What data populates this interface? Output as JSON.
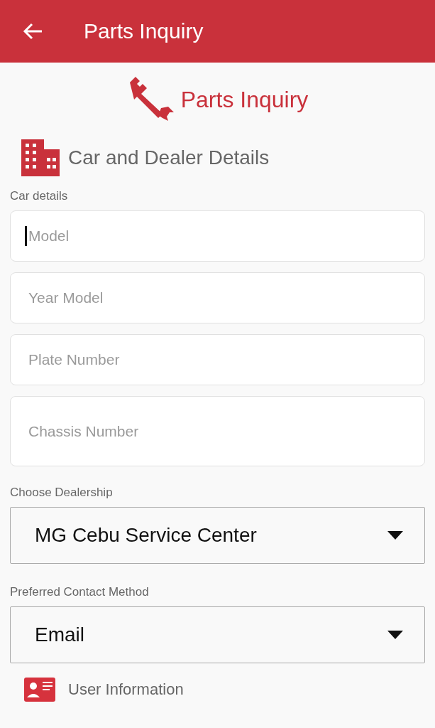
{
  "app_bar": {
    "title": "Parts Inquiry"
  },
  "page_title": "Parts Inquiry",
  "section": {
    "title": "Car and Dealer Details"
  },
  "car_details": {
    "label": "Car details",
    "fields": [
      {
        "placeholder": "Model",
        "focused": true,
        "kind": "short"
      },
      {
        "placeholder": "Year Model",
        "focused": false,
        "kind": "short"
      },
      {
        "placeholder": "Plate Number",
        "focused": false,
        "kind": "short"
      },
      {
        "placeholder": "Chassis Number",
        "focused": false,
        "kind": "tall"
      }
    ]
  },
  "selects": [
    {
      "label": "Choose Dealership",
      "value": "MG Cebu Service Center"
    },
    {
      "label": "Preferred Contact Method",
      "value": "Email"
    }
  ],
  "next_section": {
    "title": "User Information"
  }
}
